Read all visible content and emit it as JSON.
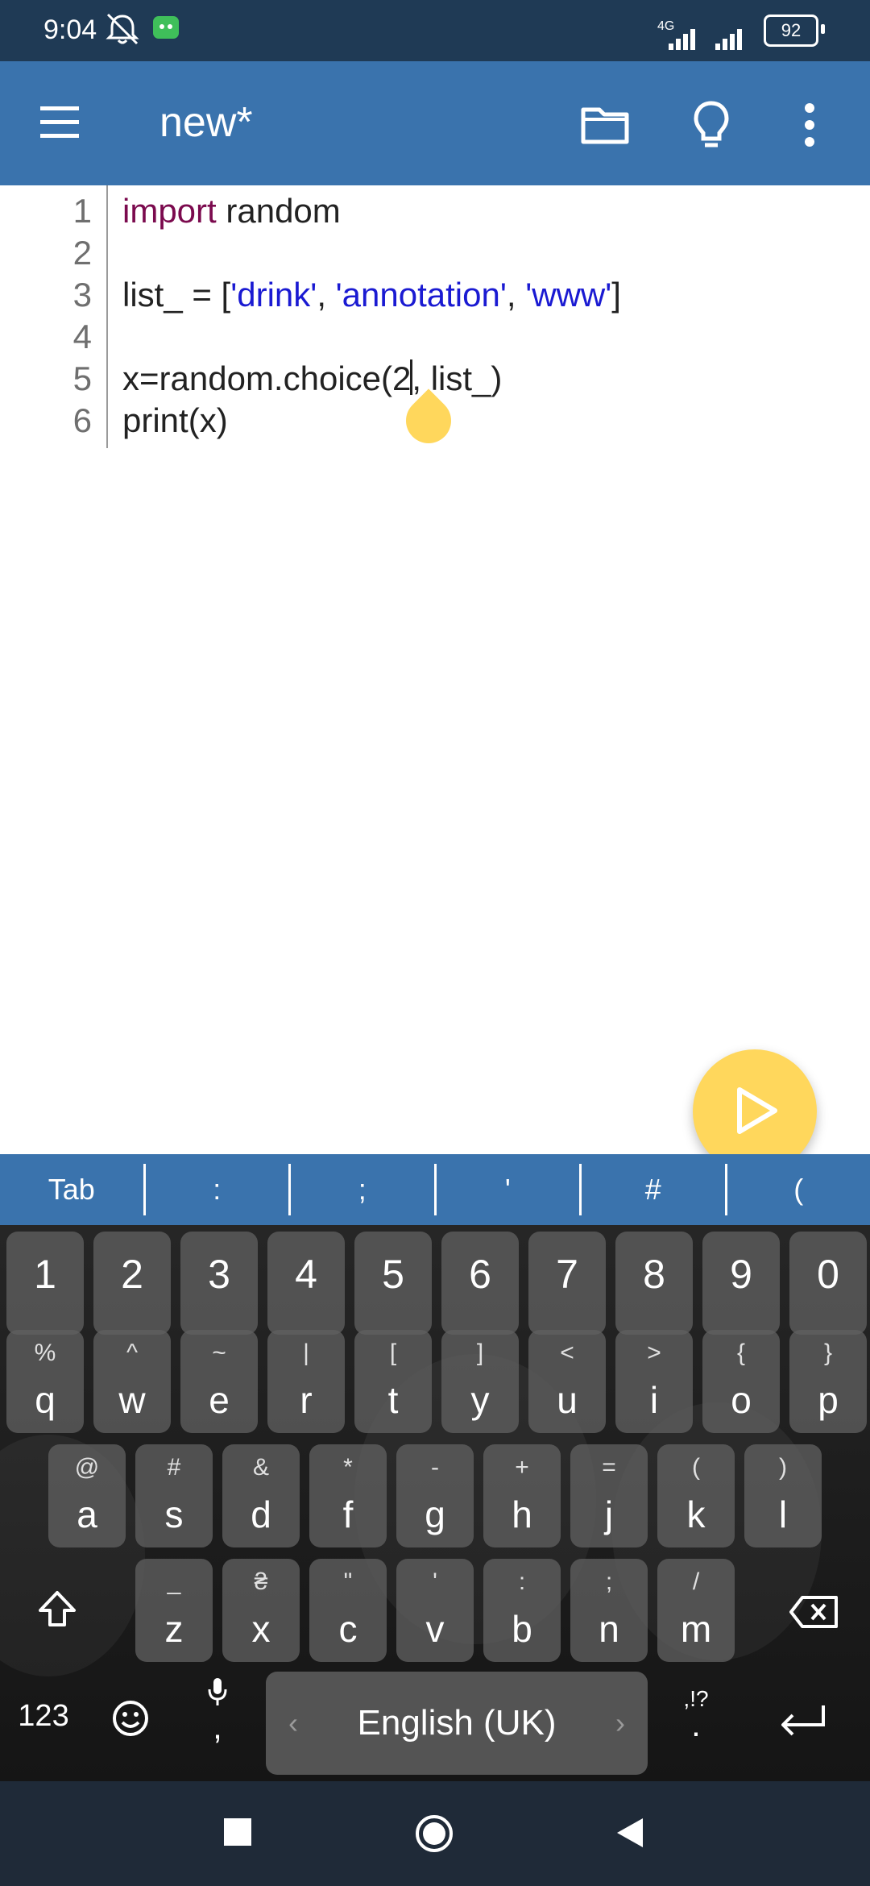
{
  "status_bar": {
    "time": "9:04",
    "network": "4G",
    "battery": "92"
  },
  "app_bar": {
    "title": "new*",
    "menu_icon": "hamburger-menu-icon",
    "folder_icon": "folder-icon",
    "lightbulb_icon": "lightbulb-icon",
    "more_icon": "more-vertical-icon"
  },
  "editor": {
    "line_numbers": [
      "1",
      "2",
      "3",
      "4",
      "5",
      "6"
    ],
    "lines": [
      {
        "kw": "import",
        "rest": " random"
      },
      {
        "text": ""
      },
      {
        "prefix": "list_ = [",
        "s1": "'drink'",
        "sep1": ", ",
        "s2": "'annotation'",
        "sep2": ", ",
        "s3": "'www'",
        "suffix": "]"
      },
      {
        "text": ""
      },
      {
        "before_cursor": "x=random.choice(2",
        "after_cursor": ", list_)"
      },
      {
        "text": "print(x)"
      }
    ]
  },
  "run_button": {
    "icon": "play-icon"
  },
  "symbol_bar": [
    "Tab",
    ":",
    ";",
    "'",
    "#",
    "("
  ],
  "keyboard": {
    "number_row": [
      "1",
      "2",
      "3",
      "4",
      "5",
      "6",
      "7",
      "8",
      "9",
      "0"
    ],
    "row1": [
      {
        "main": "q",
        "alt": "%"
      },
      {
        "main": "w",
        "alt": "^"
      },
      {
        "main": "e",
        "alt": "~"
      },
      {
        "main": "r",
        "alt": "|"
      },
      {
        "main": "t",
        "alt": "["
      },
      {
        "main": "y",
        "alt": "]"
      },
      {
        "main": "u",
        "alt": "<"
      },
      {
        "main": "i",
        "alt": ">"
      },
      {
        "main": "o",
        "alt": "{"
      },
      {
        "main": "p",
        "alt": "}"
      }
    ],
    "row2": [
      {
        "main": "a",
        "alt": "@"
      },
      {
        "main": "s",
        "alt": "#"
      },
      {
        "main": "d",
        "alt": "&"
      },
      {
        "main": "f",
        "alt": "*"
      },
      {
        "main": "g",
        "alt": "-"
      },
      {
        "main": "h",
        "alt": "+"
      },
      {
        "main": "j",
        "alt": "="
      },
      {
        "main": "k",
        "alt": "("
      },
      {
        "main": "l",
        "alt": ")"
      }
    ],
    "row3": [
      {
        "main": "z",
        "alt": "_"
      },
      {
        "main": "x",
        "alt": "₴"
      },
      {
        "main": "c",
        "alt": "\""
      },
      {
        "main": "v",
        "alt": "'"
      },
      {
        "main": "b",
        "alt": ":"
      },
      {
        "main": "n",
        "alt": ";"
      },
      {
        "main": "m",
        "alt": "/"
      }
    ],
    "shift_icon": "shift-icon",
    "backspace_icon": "backspace-icon",
    "numbers_label": "123",
    "emoji_icon": "emoji-icon",
    "mic_icon": "microphone-icon",
    "comma_label": ",",
    "space_label": "English (UK)",
    "punct_alt": ",!?",
    "punct_main": ".",
    "enter_icon": "enter-icon"
  },
  "nav_bar": {
    "recents_icon": "recents-square-icon",
    "home_icon": "home-circle-icon",
    "back_icon": "back-triangle-icon"
  }
}
